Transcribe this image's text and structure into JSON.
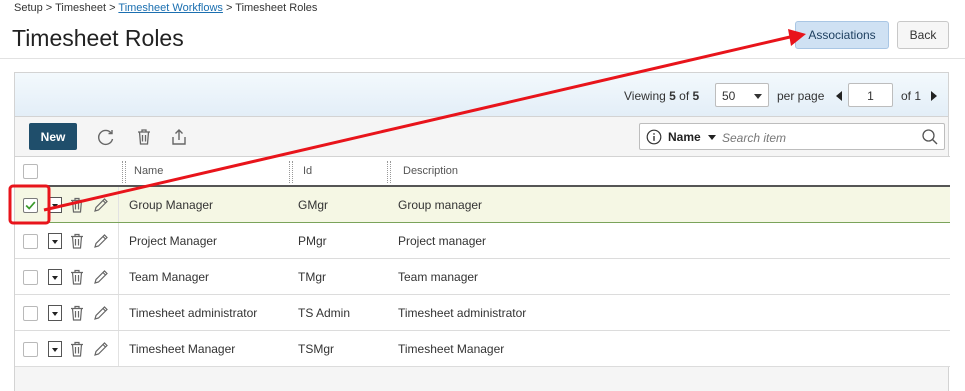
{
  "breadcrumb": {
    "setup": "Setup",
    "sep1": " > ",
    "timesheet": "Timesheet",
    "sep2": " > ",
    "workflows": "Timesheet Workflows",
    "sep3": " > ",
    "current": "Timesheet Roles"
  },
  "header": {
    "title": "Timesheet Roles",
    "associations_label": "Associations",
    "back_label": "Back"
  },
  "pager": {
    "viewing_prefix": "Viewing ",
    "shown": "5",
    "of_word": " of ",
    "total": "5",
    "per_page_value": "50",
    "per_page_label": "per page",
    "current_page": "1",
    "of_pages": "of 1"
  },
  "toolbar": {
    "new_label": "New",
    "search_field": "Name",
    "search_placeholder": "Search item"
  },
  "grid": {
    "columns": {
      "name": "Name",
      "id": "Id",
      "description": "Description"
    },
    "rows": [
      {
        "name": "Group Manager",
        "id": "GMgr",
        "description": "Group manager",
        "selected": true
      },
      {
        "name": "Project Manager",
        "id": "PMgr",
        "description": "Project manager",
        "selected": false
      },
      {
        "name": "Team Manager",
        "id": "TMgr",
        "description": "Team manager",
        "selected": false
      },
      {
        "name": "Timesheet administrator",
        "id": "TS Admin",
        "description": "Timesheet administrator",
        "selected": false
      },
      {
        "name": "Timesheet Manager",
        "id": "TSMgr",
        "description": "Timesheet Manager",
        "selected": false
      }
    ]
  },
  "icons": {
    "refresh": "refresh-icon",
    "delete": "trash-icon",
    "export": "export-icon",
    "info": "info-icon",
    "search": "search-icon",
    "row_menu": "chevron-down-icon",
    "row_delete": "trash-icon",
    "row_edit": "pencil-icon"
  },
  "colors": {
    "primary_button": "#1f4e6b",
    "associations_button": "#cfe1f3",
    "selected_row": "#f5f7e4",
    "check": "#3a9a2a",
    "annotation": "#e8141b"
  }
}
